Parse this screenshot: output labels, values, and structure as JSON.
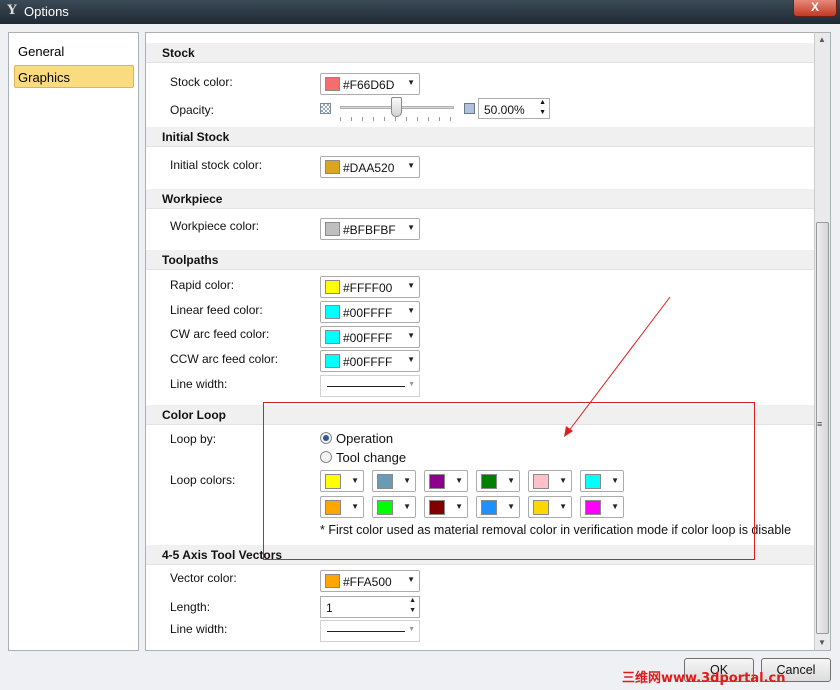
{
  "window": {
    "title": "Options",
    "close_label": "X"
  },
  "nav": {
    "items": [
      {
        "label": "General"
      },
      {
        "label": "Graphics"
      }
    ],
    "selected": "Graphics"
  },
  "stock": {
    "header": "Stock",
    "color_label": "Stock color:",
    "color_value": "#F66D6D",
    "color_hex": "#F66D6D",
    "opacity_label": "Opacity:",
    "opacity_value": "50.00%",
    "opacity_fraction": 0.5
  },
  "initial_stock": {
    "header": "Initial Stock",
    "color_label": "Initial stock color:",
    "color_value": "#DAA520",
    "color_hex": "#DAA520"
  },
  "workpiece": {
    "header": "Workpiece",
    "color_label": "Workpiece color:",
    "color_value": "#BFBFBF",
    "color_hex": "#BFBFBF"
  },
  "toolpaths": {
    "header": "Toolpaths",
    "rapid_label": "Rapid color:",
    "rapid_value": "#FFFF00",
    "rapid_hex": "#FFFF00",
    "linear_label": "Linear feed color:",
    "linear_value": "#00FFFF",
    "linear_hex": "#00FFFF",
    "cw_label": "CW arc feed color:",
    "cw_value": "#00FFFF",
    "cw_hex": "#00FFFF",
    "ccw_label": "CCW arc feed color:",
    "ccw_value": "#00FFFF",
    "ccw_hex": "#00FFFF",
    "line_width_label": "Line width:"
  },
  "color_loop": {
    "header": "Color Loop",
    "loop_by_label": "Loop by:",
    "options": [
      {
        "label": "Operation",
        "selected": true
      },
      {
        "label": "Tool change",
        "selected": false
      }
    ],
    "loop_colors_label": "Loop colors:",
    "colors": [
      "#FFFF00",
      "#6A9AB4",
      "#8B008B",
      "#008000",
      "#FFC0CB",
      "#00FFFF",
      "#FFA500",
      "#00FF00",
      "#800000",
      "#1E90FF",
      "#FFD700",
      "#FF00FF"
    ],
    "note": "* First color used as material removal color in verification mode if color loop is disable"
  },
  "axis_vectors": {
    "header": "4-5 Axis Tool Vectors",
    "color_label": "Vector color:",
    "color_value": "#FFA500",
    "color_hex": "#FFA500",
    "length_label": "Length:",
    "length_value": "1",
    "line_width_label": "Line width:"
  },
  "buttons": {
    "ok": "OK",
    "cancel": "Cancel"
  },
  "watermark": "三维网www.3dportal.cn"
}
